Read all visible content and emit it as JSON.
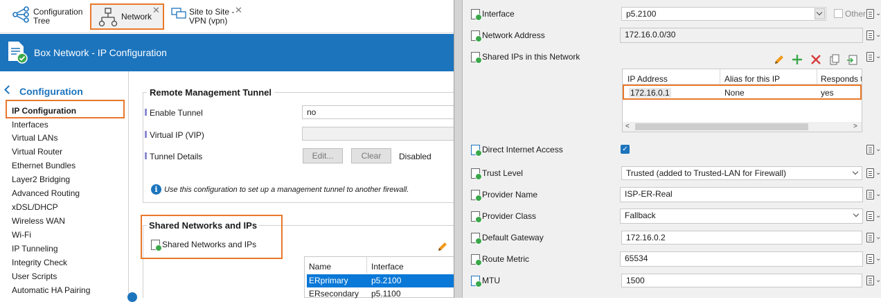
{
  "tabs": [
    {
      "label_line1": "Configuration",
      "label_line2": "Tree"
    },
    {
      "label": "Network"
    },
    {
      "label_line1": "Site to Site -",
      "label_line2": "VPN (vpn)"
    }
  ],
  "header": {
    "title": "Box Network - IP Configuration",
    "color": "#1c74bd"
  },
  "sidebar": {
    "section": "Configuration",
    "items": [
      "IP Configuration",
      "Interfaces",
      "Virtual LANs",
      "Virtual Router",
      "Ethernet Bundles",
      "Layer2 Bridging",
      "Advanced Routing",
      "xDSL/DHCP",
      "Wireless WAN",
      "Wi-Fi",
      "IP Tunneling",
      "Integrity Check",
      "User Scripts",
      "Automatic HA Pairing"
    ]
  },
  "rmt": {
    "title": "Remote Management Tunnel",
    "enable_label": "Enable Tunnel",
    "enable_value": "no",
    "vip_label": "Virtual IP (VIP)",
    "details_label": "Tunnel Details",
    "edit_btn": "Edit...",
    "clear_btn": "Clear",
    "status": "Disabled",
    "info": "Use this configuration to set up a management tunnel to another firewall."
  },
  "shared": {
    "title": "Shared Networks and IPs",
    "item_label": "Shared Networks and IPs",
    "columns": [
      "Name",
      "Interface"
    ],
    "rows": [
      [
        "ERprimary",
        "p5.2100"
      ],
      [
        "ERsecondary",
        "p5.1100"
      ]
    ]
  },
  "dialog": {
    "interface_label": "Interface",
    "interface_value": "p5.2100",
    "other_label": "Other",
    "network_label": "Network Address",
    "network_value": "172.16.0.0/30",
    "shared_ips_label": "Shared IPs in this Network",
    "ip_columns": [
      "IP Address",
      "Alias for this IP",
      "Responds to"
    ],
    "ip_rows": [
      [
        "172.16.0.1",
        "None",
        "yes"
      ]
    ],
    "direct_label": "Direct Internet Access",
    "trust_label": "Trust Level",
    "trust_value": "Trusted (added to Trusted-LAN for Firewall)",
    "provider_name_label": "Provider Name",
    "provider_name_value": "ISP-ER-Real",
    "provider_class_label": "Provider Class",
    "provider_class_value": "Fallback",
    "gateway_label": "Default Gateway",
    "gateway_value": "172.16.0.2",
    "metric_label": "Route Metric",
    "metric_value": "65534",
    "mtu_label": "MTU",
    "mtu_value": "1500"
  }
}
